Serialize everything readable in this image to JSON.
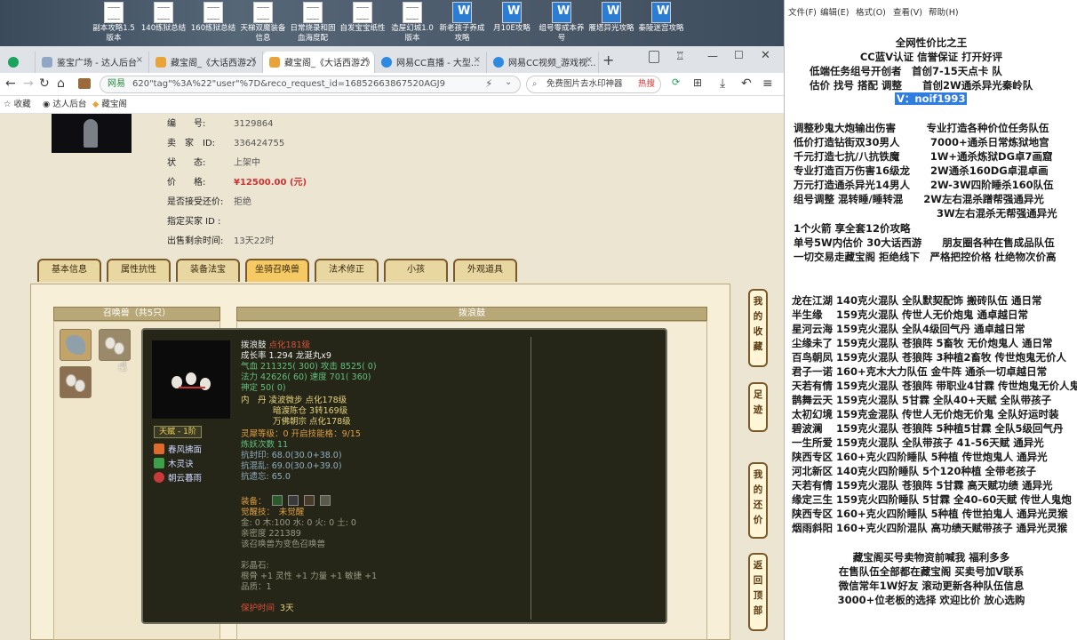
{
  "desktop_icons": [
    "副本攻略1.5版本",
    "140练狱总结",
    "160练狱总结",
    "天梯双魔装备信息",
    "日常烧录和固血海度配",
    "自发宝宝纸性",
    "造屋幻城1.0版本",
    "新老孩子养成攻略",
    "月10E攻略",
    "组号零成本养号",
    "雁塔异光攻略",
    "秦陵迷宫攻略"
  ],
  "browser": {
    "tabs": [
      "鉴宝广场 - 达人后台",
      "藏宝阁_《大话西游2》",
      "藏宝阁_《大话西游2》",
      "网易CC直播 - 大型...",
      "网易CC视频_游戏视..."
    ],
    "site_label": "网易",
    "url": "620\"tag\"%3A%22\"user\"%7D&reco_request_id=16852663867520AGJ9",
    "search_placeholder": "免费图片去水印神器",
    "search_hot": "热搜",
    "fav_items": [
      "收藏",
      "达人后台",
      "藏宝阁"
    ]
  },
  "item": {
    "fields": [
      {
        "k": "编　　号:",
        "v": "3129864"
      },
      {
        "k": "卖　家　ID:",
        "v": "336424755"
      },
      {
        "k": "状　　态:",
        "v": "上架中"
      },
      {
        "k": "价　　格:",
        "v": "¥12500.00 (元)"
      },
      {
        "k": "是否接受还价:",
        "v": "拒绝"
      },
      {
        "k": "指定买家 ID :",
        "v": ""
      },
      {
        "k": "出售剩余时间:",
        "v": "13天22时"
      }
    ]
  },
  "nav_tabs": [
    "基本信息",
    "属性抗性",
    "装备法宝",
    "坐骑召唤兽",
    "法术修正",
    "小孩",
    "外观道具"
  ],
  "pet_panel_title": "召唤兽（共5只）",
  "detail_title": "拨浪鼓",
  "tooltip": {
    "line1_name": "拨浪鼓",
    "line1_tag": "点化181级",
    "line2": "成长率 1.294 龙涎丸x9",
    "line3": "气血 211325( 300) 攻击 8525( 0)",
    "line4": "法力 42626( 60) 速度 701( 360)",
    "line5": "神定 50( 0)",
    "line6a": "内　丹 凌波微步 点化178级",
    "line6b": "暗渡陈仓 3转169级",
    "line6c": "万佛朝宗 点化178级",
    "line7": "灵犀等级：0 开启技能格：9/15",
    "line8": "炼妖次数 11",
    "line9": "抗封印: 68.0(30.0+38.0)",
    "line10": "抗混乱: 69.0(30.0+39.0)",
    "line11": "抗遗忘: 65.0",
    "line12": "装备：",
    "line13": "觉醒技：　未觉醒",
    "line14": "金: 0 木:100 水: 0 火: 0 土: 0",
    "line15": "亲密度 221389",
    "line16": "该召唤兽为变色召唤兽",
    "line17": "彩晶石:",
    "line18": "根骨 +1 灵性 +1 力量 +1 敏捷 +1",
    "line19": "品质：1",
    "line20a": "保护时间",
    "line20b": "3天",
    "talent": "天赋 - 1阶",
    "skills": [
      "春风拂面",
      "木灵诀",
      "朝云暮雨"
    ]
  },
  "side_buttons": [
    "我的收藏",
    "足迹",
    "我的还价",
    "返回顶部"
  ],
  "notepad": {
    "menu": [
      "文件(F)",
      "编辑(E)",
      "格式(O)",
      "查看(V)",
      "帮助(H)"
    ],
    "header": [
      "全网性价比之王",
      "CC蓝V认证 信誉保证 打开好评",
      "低端任务组号开创者　首创7-15天点卡 队",
      "估价 找号 搭配 调整　　首创2W通杀异光秦岭队"
    ],
    "contact": "V：noif1993",
    "sec1": [
      "调整秒鬼大炮输出伤害　　　专业打造各种价位任务队伍",
      "低价打造钻街双30男人　　　7000+通杀日常炼狱地宫",
      "千元打造七抗/八抗铁魔　　　1W+通杀炼狱DG卓7画窟",
      "专业打造百万伤害16级龙　　2W通杀160DG卓混卓画",
      "万元打造通杀异光14男人　　2W-3W四阶睡杀160队伍",
      "组号调整 混转睡/睡转混　　2W左右混杀蹭帮强通异光",
      "　　　　　　　　　　　　　　3W左右混杀无帮强通异光"
    ],
    "sec2": [
      "1个火箭 享全套12价攻略",
      "单号5W内估价 30大话西游　　朋友圈各种在售成品队伍",
      "一切交易走藏宝阁 拒绝线下　严格把控价格 杜绝物次价高"
    ],
    "sec3": [
      "龙在江湖 140克火混队 全队默契配饰 搬砖队伍 通日常",
      "半生缘　 159克火混队 传世人无价炮鬼 通卓越日常",
      "星河云海 159克火混队 全队4级回气丹 通卓越日常",
      "尘缘未了 159克火混队 苍狼阵 5畜牧 无价炮鬼人 通日常",
      "百鸟朝凤 159克火混队 苍狼阵 3种植2畜牧 传世炮鬼无价人",
      "君子一诺 160+克木大力队伍 金牛阵 通杀一切卓越日常",
      "天若有情 159克火混队 苍狼阵 带职业4甘霖 传世炮鬼无价人鬼",
      "鹊舞云天 159克火混队 5甘霖 全队40+天赋 全队带孩子",
      "太初幻境 159克金混队 传世人无价炮无价鬼 全队好运时装",
      "碧波澜　 159克火混队 苍狼阵 5种植5甘霖 全队5级回气丹",
      "一生所爱 159克火混队 全队带孩子 41-56天赋 通异光",
      "陕西专区 160+克火四阶睡队 5种植 传世炮鬼人 通异光",
      "河北新区 140克火四阶睡队 5个120种植 全带老孩子",
      "天若有情 159克火混队 苍狼阵 5甘霖 高天赋功绩 通异光",
      "缘定三生 159克火四阶睡队 5甘霖 全40-60天赋 传世人鬼炮",
      "陕西专区 160+克火四阶睡队 5种植 传世拍鬼人 通异光灵猴",
      "烟雨斜阳 160+克火四阶混队 高功绩天赋带孩子 通异光灵猴"
    ],
    "footer": [
      "藏宝阁买号卖物资前喊我 福利多多",
      "在售队伍全部都在藏宝阁 买卖号加V联系",
      "微信常年1W好友 滚动更新各种队伍信息",
      "3000+位老板的选择 欢迎比价 放心选购"
    ]
  }
}
